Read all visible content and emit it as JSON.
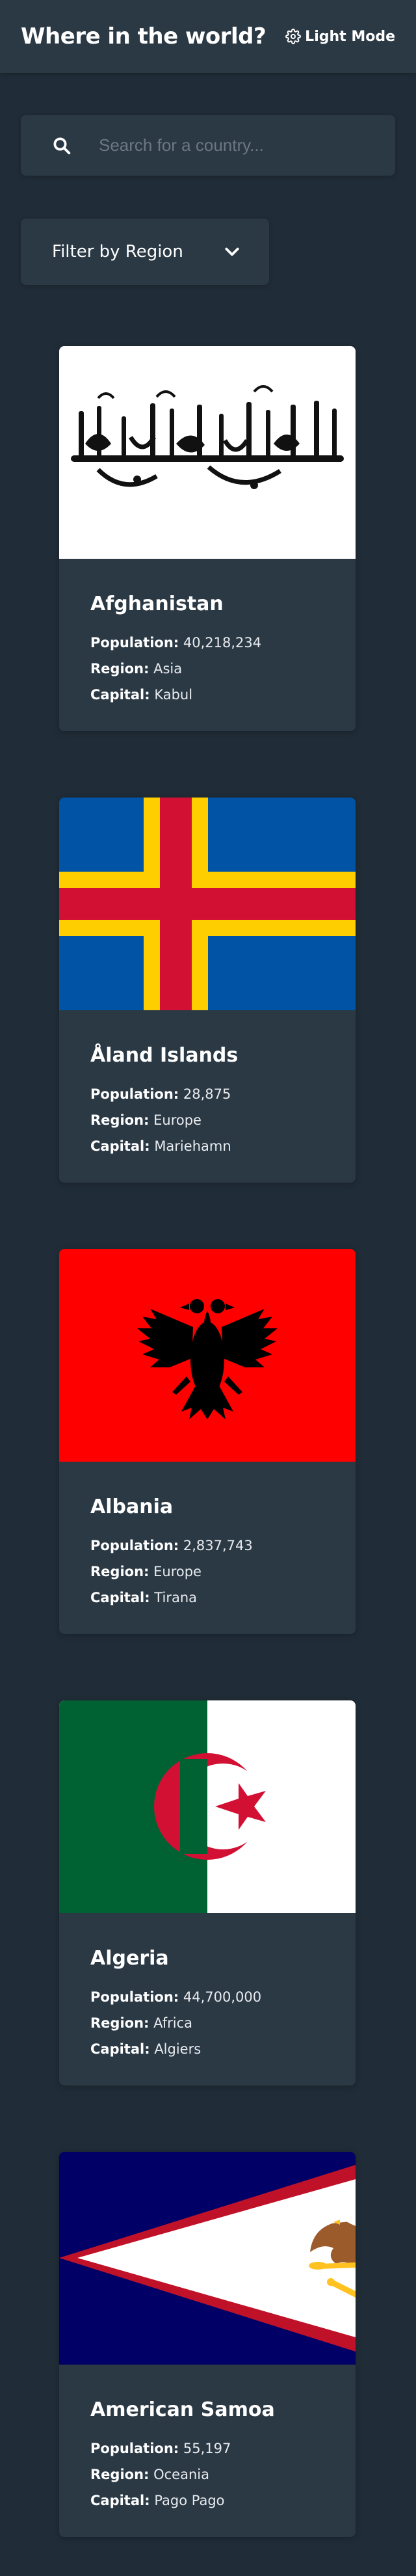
{
  "header": {
    "title": "Where in the world?",
    "mode_label": "Light Mode",
    "mode_icon": "gear-icon"
  },
  "search": {
    "placeholder": "Search for a country...",
    "value": "",
    "icon": "search-icon"
  },
  "filter": {
    "label": "Filter by Region",
    "icon": "chevron-down-icon"
  },
  "labels": {
    "population": "Population:",
    "region": "Region:",
    "capital": "Capital:"
  },
  "colors": {
    "background": "#202c37",
    "element": "#2b3945",
    "text": "#ffffff"
  },
  "countries": [
    {
      "name": "Afghanistan",
      "population": "40,218,234",
      "region": "Asia",
      "capital": "Kabul",
      "flag": "afghanistan-flag"
    },
    {
      "name": "Åland Islands",
      "population": "28,875",
      "region": "Europe",
      "capital": "Mariehamn",
      "flag": "aland-islands-flag"
    },
    {
      "name": "Albania",
      "population": "2,837,743",
      "region": "Europe",
      "capital": "Tirana",
      "flag": "albania-flag"
    },
    {
      "name": "Algeria",
      "population": "44,700,000",
      "region": "Africa",
      "capital": "Algiers",
      "flag": "algeria-flag"
    },
    {
      "name": "American Samoa",
      "population": "55,197",
      "region": "Oceania",
      "capital": "Pago Pago",
      "flag": "american-samoa-flag"
    }
  ]
}
